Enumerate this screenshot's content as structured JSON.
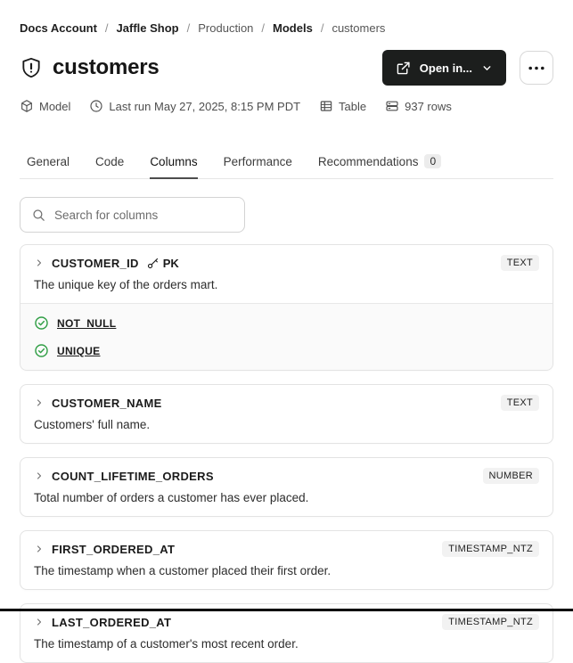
{
  "breadcrumb": {
    "separator": "/",
    "items": [
      {
        "label": "Docs Account"
      },
      {
        "label": "Jaffle Shop"
      },
      {
        "label": "Production"
      },
      {
        "label": "Models"
      },
      {
        "label": "customers"
      }
    ]
  },
  "header": {
    "title": "customers",
    "open_in_label": "Open in...",
    "more_label": "more options"
  },
  "meta": {
    "items": [
      {
        "icon": "cube-icon",
        "label": "Model"
      },
      {
        "icon": "clock-icon",
        "label": "Last run May 27, 2025, 8:15 PM PDT"
      },
      {
        "icon": "table-icon",
        "label": "Table"
      },
      {
        "icon": "rows-icon",
        "label": "937 rows"
      }
    ]
  },
  "tabs": [
    {
      "label": "General",
      "active": false
    },
    {
      "label": "Code",
      "active": false
    },
    {
      "label": "Columns",
      "active": true
    },
    {
      "label": "Performance",
      "active": false
    },
    {
      "label": "Recommendations",
      "active": false,
      "badge": "0"
    }
  ],
  "search": {
    "placeholder": "Search for columns",
    "value": ""
  },
  "columns": [
    {
      "name": "CUSTOMER_ID",
      "pk_label": "PK",
      "type": "TEXT",
      "description": "The unique key of the orders mart.",
      "tests": [
        "NOT_NULL",
        "UNIQUE"
      ]
    },
    {
      "name": "CUSTOMER_NAME",
      "type": "TEXT",
      "description": "Customers' full name."
    },
    {
      "name": "COUNT_LIFETIME_ORDERS",
      "type": "NUMBER",
      "description": "Total number of orders a customer has ever placed."
    },
    {
      "name": "FIRST_ORDERED_AT",
      "type": "TIMESTAMP_NTZ",
      "description": "The timestamp when a customer placed their first order."
    },
    {
      "name": "LAST_ORDERED_AT",
      "type": "TIMESTAMP_NTZ",
      "description": "The timestamp of a customer's most recent order."
    }
  ],
  "colors": {
    "primary_button_bg": "#1c1e1d",
    "test_pass_green": "#2f9e44",
    "type_badge_bg": "#f2f2f2",
    "tab_underline": "#4d4d4d",
    "card_border": "#e3e3e3"
  }
}
